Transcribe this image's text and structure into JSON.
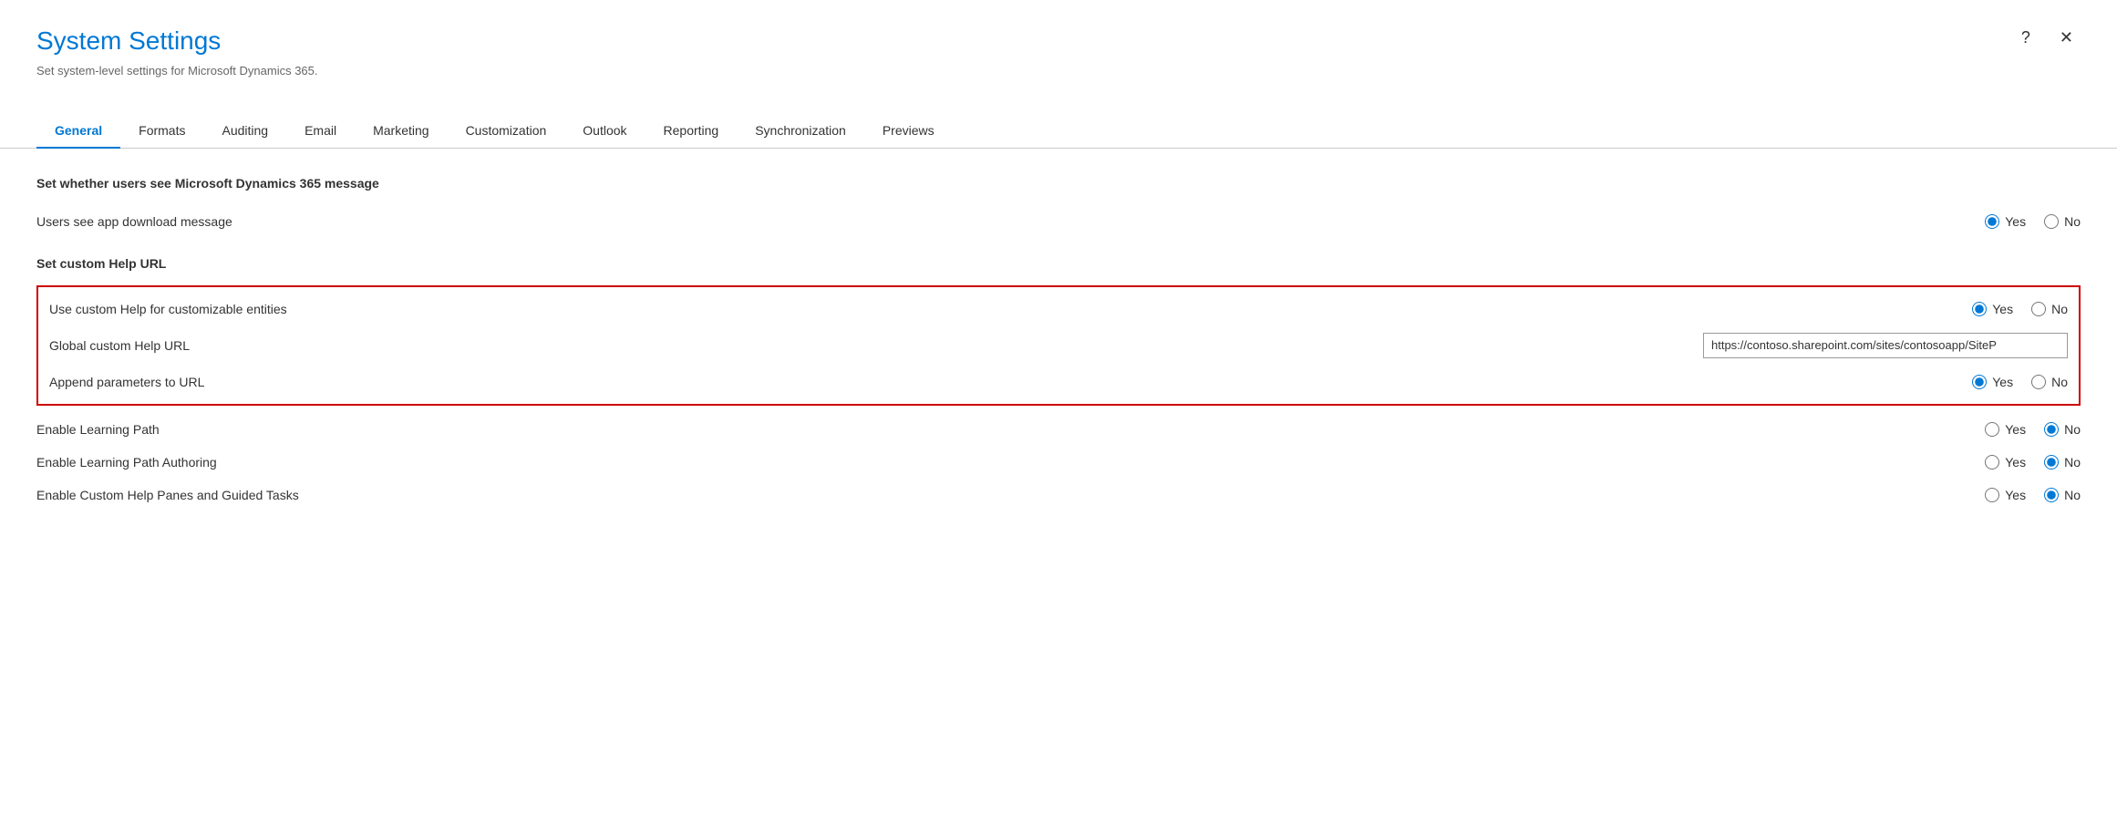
{
  "dialog": {
    "title": "System Settings",
    "subtitle": "Set system-level settings for Microsoft Dynamics 365.",
    "help_label": "?",
    "close_label": "✕"
  },
  "tabs": [
    {
      "id": "general",
      "label": "General",
      "active": true
    },
    {
      "id": "formats",
      "label": "Formats",
      "active": false
    },
    {
      "id": "auditing",
      "label": "Auditing",
      "active": false
    },
    {
      "id": "email",
      "label": "Email",
      "active": false
    },
    {
      "id": "marketing",
      "label": "Marketing",
      "active": false
    },
    {
      "id": "customization",
      "label": "Customization",
      "active": false
    },
    {
      "id": "outlook",
      "label": "Outlook",
      "active": false
    },
    {
      "id": "reporting",
      "label": "Reporting",
      "active": false
    },
    {
      "id": "synchronization",
      "label": "Synchronization",
      "active": false
    },
    {
      "id": "previews",
      "label": "Previews",
      "active": false
    }
  ],
  "sections": {
    "section1": {
      "title": "Set whether users see Microsoft Dynamics 365 message",
      "settings": [
        {
          "id": "app_download_message",
          "label": "Users see app download message",
          "type": "radio",
          "value": "yes",
          "options": [
            "Yes",
            "No"
          ]
        }
      ]
    },
    "section2": {
      "title": "Set custom Help URL",
      "highlighted": true,
      "settings": [
        {
          "id": "custom_help_entities",
          "label": "Use custom Help for customizable entities",
          "type": "radio",
          "value": "yes",
          "options": [
            "Yes",
            "No"
          ]
        },
        {
          "id": "global_custom_help_url",
          "label": "Global custom Help URL",
          "type": "text",
          "value": "https://contoso.sharepoint.com/sites/contosoapp/SiteP"
        },
        {
          "id": "append_parameters",
          "label": "Append parameters to URL",
          "type": "radio",
          "value": "yes",
          "options": [
            "Yes",
            "No"
          ]
        }
      ]
    },
    "section3": {
      "settings": [
        {
          "id": "enable_learning_path",
          "label": "Enable Learning Path",
          "type": "radio",
          "value": "no",
          "options": [
            "Yes",
            "No"
          ]
        },
        {
          "id": "enable_learning_path_authoring",
          "label": "Enable Learning Path Authoring",
          "type": "radio",
          "value": "no",
          "options": [
            "Yes",
            "No"
          ]
        },
        {
          "id": "enable_custom_help_panes",
          "label": "Enable Custom Help Panes and Guided Tasks",
          "type": "radio",
          "value": "no",
          "options": [
            "Yes",
            "No"
          ]
        }
      ]
    }
  },
  "radio_yes": "Yes",
  "radio_no": "No"
}
